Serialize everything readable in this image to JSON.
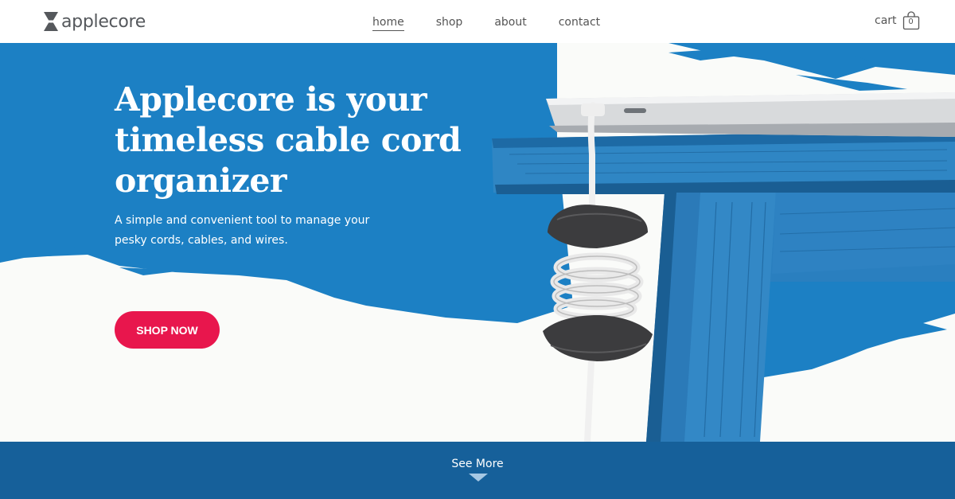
{
  "brand": {
    "name": "applecore",
    "logo_icon": "hourglass-logo-icon"
  },
  "nav": {
    "items": [
      {
        "label": "home",
        "active": true
      },
      {
        "label": "shop",
        "active": false
      },
      {
        "label": "about",
        "active": false
      },
      {
        "label": "contact",
        "active": false
      }
    ]
  },
  "cart": {
    "label": "cart",
    "count": "0",
    "icon": "shopping-bag-icon"
  },
  "hero": {
    "headline": "Applecore is your timeless cable cord organizer",
    "subtext": "A simple and convenient tool to manage your pesky cords, cables, and wires.",
    "cta_label": "SHOP NOW",
    "image": "laptop on blue table with cable wound around organizer"
  },
  "see_more": {
    "label": "See More",
    "icon": "chevron-down-icon"
  },
  "colors": {
    "brand_blue": "#1c80c4",
    "dark_blue": "#16609a",
    "cta_red": "#e8164d",
    "text_gray": "#555555"
  }
}
